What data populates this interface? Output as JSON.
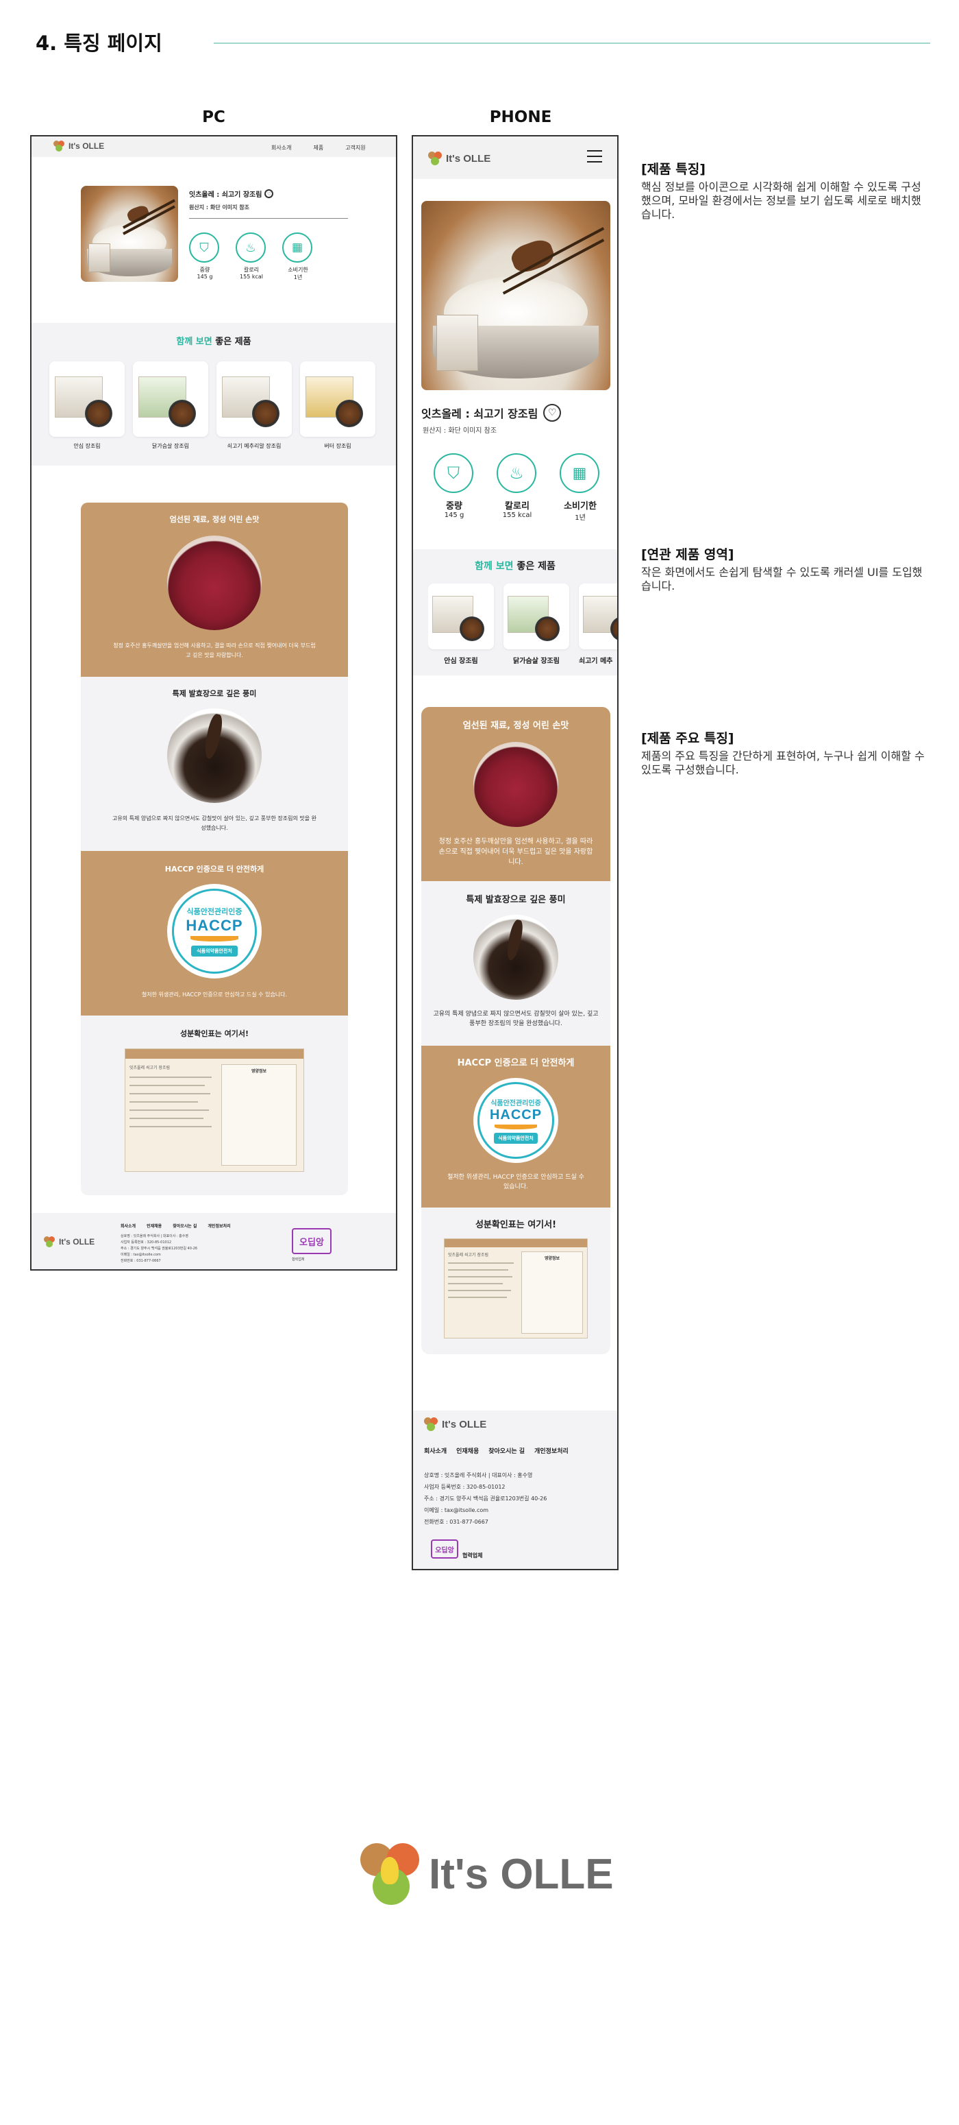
{
  "page": {
    "section_title": "4. 특징 페이지",
    "col_pc": "PC",
    "col_phone": "PHONE"
  },
  "brand": {
    "logo_text": "It's OLLE",
    "accent": "#29b79f",
    "tan": "#c59a6c"
  },
  "pc": {
    "nav": [
      "회사소개",
      "제품",
      "고객지원"
    ],
    "product": {
      "name": "잇츠올레 : 쇠고기 장조림",
      "origin": "원산지 : 화단 이미지 참조",
      "specs": [
        {
          "icon": "bag-icon",
          "label": "중량",
          "value": "145 g"
        },
        {
          "icon": "flame-icon",
          "label": "칼로리",
          "value": "155 kcal"
        },
        {
          "icon": "calendar-icon",
          "label": "소비기한",
          "value": "1년"
        }
      ]
    },
    "related": {
      "title_accent": "함께 보면",
      "title_rest": " 좋은 제품",
      "items": [
        "안심 장조림",
        "닭가슴살 장조림",
        "쇠고기 메추리알 장조림",
        "버터 장조림"
      ]
    },
    "features": [
      {
        "title": "엄선된 재료, 정성 어린 손맛",
        "text": "청정 호주산 홍두깨살만을 엄선해 사용하고, 결을 따라 손으로 직접 찢어내어 더욱 부드럽고 깊은 맛을 자랑합니다."
      },
      {
        "title": "특제 발효장으로 깊은 풍미",
        "text": "고유의 특제 양념으로 짜지 않으면서도 감칠맛이 살아 있는, 깊고 풍부한 장조림의 맛을 완성했습니다."
      },
      {
        "title": "HACCP 인증으로 더 안전하게",
        "text": "철저한 위생관리, HACCP 인증으로 안심하고 드실 수 있습니다."
      },
      {
        "title": "성분확인표는 여기서!",
        "text": ""
      }
    ],
    "footer": {
      "links": [
        "회사소개",
        "인재채용",
        "찾아오시는 길",
        "개인정보처리"
      ],
      "info": [
        "상호명 : 잇츠올레 주식회사 | 대표이사 : 홍수영",
        "사업자 등록번호 : 320-85-01012",
        "주소 : 경기도 양주시 백석읍 권율로1203번길 40-26",
        "이메일 : tax@itsolle.com",
        "전화번호 : 031-877-0667"
      ],
      "partner": "협력업체"
    }
  },
  "phone": {
    "product": {
      "name": "잇츠올레 : 쇠고기 장조림",
      "origin": "원산지 : 화단 이미지 참조",
      "specs": [
        {
          "label": "중량",
          "value": "145 g"
        },
        {
          "label": "칼로리",
          "value": "155 kcal"
        },
        {
          "label": "소비기한",
          "value": "1년"
        }
      ]
    },
    "related": {
      "title_accent": "함께 보면",
      "title_rest": " 좋은 제품",
      "items": [
        "안심 장조림",
        "닭가슴살 장조림",
        "쇠고기 메추"
      ]
    },
    "features": [
      {
        "title": "엄선된 재료, 정성 어린 손맛",
        "text": "청정 호주산 홍두깨살만을 엄선해 사용하고, 결을 따라 손으로 직접 찢어내어 더욱 부드럽고 깊은 맛을 자랑합니다."
      },
      {
        "title": "특제 발효장으로 깊은 풍미",
        "text": "고유의 특제 양념으로 짜지 않으면서도 감칠맛이 살아 있는, 깊고 풍부한 장조림의 맛을 완성했습니다."
      },
      {
        "title": "HACCP 인증으로 더 안전하게",
        "text": "철저한 위생관리, HACCP 인증으로 안심하고 드실 수 있습니다."
      },
      {
        "title": "성분확인표는 여기서!",
        "text": ""
      }
    ],
    "footer": {
      "links": [
        "회사소개",
        "인재채용",
        "찾아오시는 길",
        "개인정보처리"
      ],
      "info": [
        "상호명 : 잇츠올레 주식회사 | 대표이사 : 홍수영",
        "사업자 등록번호 : 320-85-01012",
        "주소 : 경기도 양주시 백석읍 권율로1203번길 40-26",
        "이메일 : tax@itsolle.com",
        "전화번호 : 031-877-0667"
      ],
      "partner": "협력업체"
    }
  },
  "haccp": {
    "top": "식품안전관리인증",
    "mid": "HACCP",
    "bottom": "식품의약품안전처"
  },
  "ordinal_logo": "오딥앙",
  "doc": {
    "title": "잇츠올레 쇠고기 장조림",
    "panel": "영양정보"
  },
  "descriptions": [
    {
      "title": "[제품 특징]",
      "text": "핵심 정보를 아이콘으로 시각화해 쉽게 이해할 수 있도록 구성했으며, 모바일 환경에서는 정보를 보기 쉽도록 세로로 배치했습니다."
    },
    {
      "title": "[연관 제품 영역]",
      "text": "작은 화면에서도 손쉽게 탐색할 수 있도록 캐러셀 UI를 도입했습니다."
    },
    {
      "title": "[제품 주요 특징]",
      "text": "제품의 주요 특징을 간단하게 표현하여, 누구나 쉽게 이해할 수 있도록 구성했습니다."
    }
  ]
}
